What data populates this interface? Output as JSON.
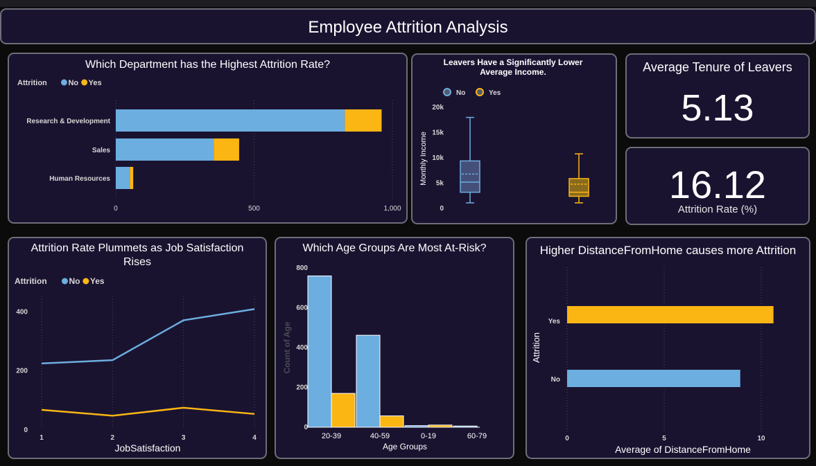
{
  "dashboard": {
    "title": "Employee Attrition Analysis"
  },
  "colors": {
    "no": "#6caee0",
    "yes": "#fbb614",
    "card_bg": "#1a1330",
    "border": "#6e6e78",
    "grid": "#4a4a5a"
  },
  "legend": {
    "title": "Attrition",
    "no": "No",
    "yes": "Yes"
  },
  "kpis": {
    "tenure": {
      "title": "Average Tenure of Leavers",
      "value": "5.13"
    },
    "rate": {
      "value": "16.12",
      "label": "Attrition Rate (%)"
    }
  },
  "chart_data": [
    {
      "id": "dept",
      "type": "bar",
      "orientation": "horizontal",
      "stacked": true,
      "title": "Which Department has the Highest Attrition Rate?",
      "categories": [
        "Research & Development",
        "Sales",
        "Human Resources"
      ],
      "series": [
        {
          "name": "No",
          "values": [
            828,
            354,
            51
          ]
        },
        {
          "name": "Yes",
          "values": [
            133,
            92,
            12
          ]
        }
      ],
      "xlim": [
        0,
        1000
      ],
      "xticks": [
        "0",
        "500",
        "1,000"
      ],
      "legend": "top-left",
      "grid": true
    },
    {
      "id": "income",
      "type": "box",
      "title": "Leavers Have a Significantly Lower Average Income.",
      "ylabel": "Monthly Income",
      "ylim": [
        0,
        20000
      ],
      "yticks": [
        "0",
        "5k",
        "10k",
        "15k",
        "20k"
      ],
      "boxes": [
        {
          "name": "No",
          "min": 1100,
          "q1": 3200,
          "median": 5200,
          "mean": 6800,
          "q3": 9400,
          "max": 18000
        },
        {
          "name": "Yes",
          "min": 1100,
          "q1": 2400,
          "median": 3200,
          "mean": 4800,
          "q3": 5900,
          "max": 10800
        }
      ],
      "legend": "top-left"
    },
    {
      "id": "satisfaction",
      "type": "line",
      "title": "Attrition Rate Plummets as Job Satisfaction Rises",
      "xlabel": "JobSatisfaction",
      "x": [
        "1",
        "2",
        "3",
        "4"
      ],
      "series": [
        {
          "name": "No",
          "values": [
            223,
            234,
            369,
            407
          ]
        },
        {
          "name": "Yes",
          "values": [
            66,
            46,
            73,
            52
          ]
        }
      ],
      "ylim": [
        0,
        450
      ],
      "yticks": [
        "0",
        "200",
        "400"
      ],
      "legend": "top-left",
      "grid": true
    },
    {
      "id": "age",
      "type": "bar",
      "title": "Which Age Groups Are Most At-Risk?",
      "xlabel": "Age Groups",
      "ylabel": "Count of Age",
      "categories": [
        "20-39",
        "40-59",
        "0-19",
        "60-79"
      ],
      "series": [
        {
          "name": "No",
          "values": [
            760,
            462,
            8,
            6
          ]
        },
        {
          "name": "Yes",
          "values": [
            170,
            57,
            11,
            0
          ]
        }
      ],
      "ylim": [
        0,
        800
      ],
      "yticks": [
        "0",
        "200",
        "400",
        "600",
        "800"
      ]
    },
    {
      "id": "distance",
      "type": "bar",
      "orientation": "horizontal",
      "title": "Higher DistanceFromHome causes more Attrition",
      "xlabel": "Average of DistanceFromHome",
      "ylabel": "Attrition",
      "categories": [
        "Yes",
        "No"
      ],
      "values": [
        10.63,
        8.92
      ],
      "xlim": [
        0,
        11
      ],
      "xticks": [
        "0",
        "5",
        "10"
      ],
      "grid": true
    }
  ]
}
